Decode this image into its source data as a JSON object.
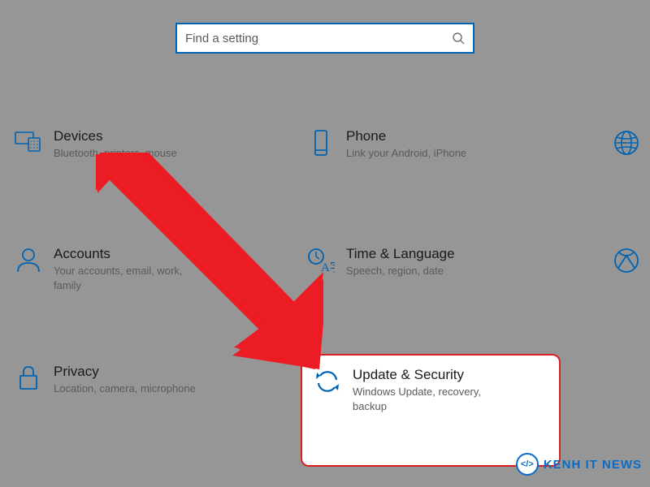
{
  "search": {
    "placeholder": "Find a setting"
  },
  "tiles": {
    "row1": [
      {
        "title": "Devices",
        "sub": "Bluetooth, printers, mouse",
        "icon": "devices"
      },
      {
        "title": "Phone",
        "sub": "Link your Android, iPhone",
        "icon": "phone"
      },
      {
        "title": "",
        "sub": "",
        "icon": "globe"
      }
    ],
    "row2": [
      {
        "title": "Accounts",
        "sub": "Your accounts, email, work, family",
        "icon": "person"
      },
      {
        "title": "Time & Language",
        "sub": "Speech, region, date",
        "icon": "time-lang"
      },
      {
        "title": "",
        "sub": "",
        "icon": "xbox"
      }
    ],
    "row3": [
      {
        "title": "Privacy",
        "sub": "Location, camera, microphone",
        "icon": "lock"
      },
      {
        "title": "Update & Security",
        "sub": "Windows Update, recovery, backup",
        "icon": "sync"
      }
    ]
  },
  "watermark": {
    "logo_text": "</>",
    "text": "KENH IT NEWS"
  }
}
